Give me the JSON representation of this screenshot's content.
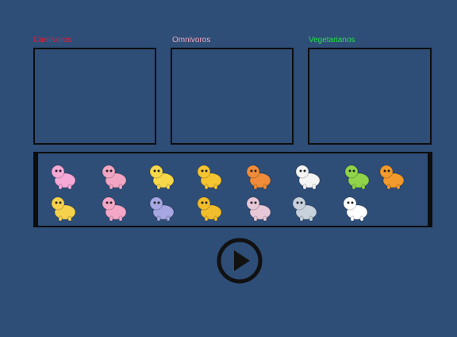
{
  "categories": [
    {
      "id": "carn",
      "label": "Carnivoros",
      "color": "#e0203a"
    },
    {
      "id": "omni",
      "label": "Omnivoros",
      "color": "#f0a7bf"
    },
    {
      "id": "veg",
      "label": "Vegetarianos",
      "color": "#23e04a"
    }
  ],
  "animals": [
    {
      "name": "unicorn-animal",
      "color": "#f6a9d6"
    },
    {
      "name": "pig-animal",
      "color": "#f3a6c3"
    },
    {
      "name": "yellow-dog-animal",
      "color": "#f7d84a"
    },
    {
      "name": "giraffe-animal",
      "color": "#f5c431"
    },
    {
      "name": "orange-dog-animal",
      "color": "#f08c3a"
    },
    {
      "name": "white-sheep-animal",
      "color": "#f4f4f4"
    },
    {
      "name": "green-dino-animal",
      "color": "#8fd44a"
    },
    {
      "name": "orange-cat-animal",
      "color": "#f39a2c"
    },
    {
      "name": "yellow-giraffe-animal",
      "color": "#f6d24c"
    },
    {
      "name": "pink-rabbit-animal",
      "color": "#f5a7c8"
    },
    {
      "name": "hippo-animal",
      "color": "#a7a7e3"
    },
    {
      "name": "lion-animal",
      "color": "#f1bd2c"
    },
    {
      "name": "sheep-animal",
      "color": "#e8c8d8"
    },
    {
      "name": "mouse-animal",
      "color": "#c8d2dc"
    },
    {
      "name": "cow-animal",
      "color": "#ffffff"
    }
  ],
  "play_button": {
    "icon": "play-icon",
    "color": "#111111"
  }
}
